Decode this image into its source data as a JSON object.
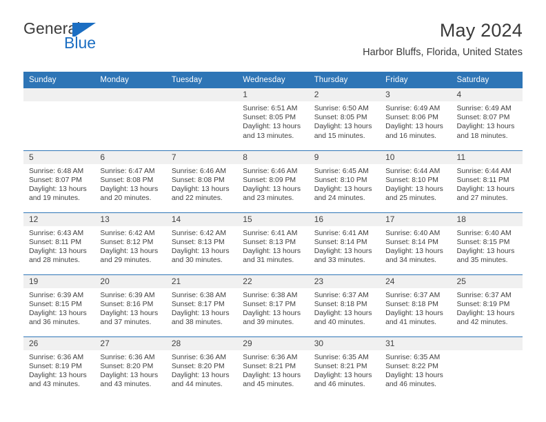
{
  "logo": {
    "word_general": "General",
    "word_blue": "Blue",
    "flag_color": "#1b6ec2"
  },
  "header": {
    "title": "May 2024",
    "subtitle": "Harbor Bluffs, Florida, United States",
    "accent_color": "#2e75b6",
    "daynum_band_color": "#f0f0f0"
  },
  "weekdays": [
    "Sunday",
    "Monday",
    "Tuesday",
    "Wednesday",
    "Thursday",
    "Friday",
    "Saturday"
  ],
  "labels": {
    "sunrise": "Sunrise:",
    "sunset": "Sunset:",
    "daylight": "Daylight:"
  },
  "weeks": [
    [
      {
        "day": "",
        "blank": true
      },
      {
        "day": "",
        "blank": true
      },
      {
        "day": "",
        "blank": true
      },
      {
        "day": "1",
        "sunrise": "Sunrise: 6:51 AM",
        "sunset": "Sunset: 8:05 PM",
        "daylight": "Daylight: 13 hours and 13 minutes."
      },
      {
        "day": "2",
        "sunrise": "Sunrise: 6:50 AM",
        "sunset": "Sunset: 8:05 PM",
        "daylight": "Daylight: 13 hours and 15 minutes."
      },
      {
        "day": "3",
        "sunrise": "Sunrise: 6:49 AM",
        "sunset": "Sunset: 8:06 PM",
        "daylight": "Daylight: 13 hours and 16 minutes."
      },
      {
        "day": "4",
        "sunrise": "Sunrise: 6:49 AM",
        "sunset": "Sunset: 8:07 PM",
        "daylight": "Daylight: 13 hours and 18 minutes."
      }
    ],
    [
      {
        "day": "5",
        "sunrise": "Sunrise: 6:48 AM",
        "sunset": "Sunset: 8:07 PM",
        "daylight": "Daylight: 13 hours and 19 minutes."
      },
      {
        "day": "6",
        "sunrise": "Sunrise: 6:47 AM",
        "sunset": "Sunset: 8:08 PM",
        "daylight": "Daylight: 13 hours and 20 minutes."
      },
      {
        "day": "7",
        "sunrise": "Sunrise: 6:46 AM",
        "sunset": "Sunset: 8:08 PM",
        "daylight": "Daylight: 13 hours and 22 minutes."
      },
      {
        "day": "8",
        "sunrise": "Sunrise: 6:46 AM",
        "sunset": "Sunset: 8:09 PM",
        "daylight": "Daylight: 13 hours and 23 minutes."
      },
      {
        "day": "9",
        "sunrise": "Sunrise: 6:45 AM",
        "sunset": "Sunset: 8:10 PM",
        "daylight": "Daylight: 13 hours and 24 minutes."
      },
      {
        "day": "10",
        "sunrise": "Sunrise: 6:44 AM",
        "sunset": "Sunset: 8:10 PM",
        "daylight": "Daylight: 13 hours and 25 minutes."
      },
      {
        "day": "11",
        "sunrise": "Sunrise: 6:44 AM",
        "sunset": "Sunset: 8:11 PM",
        "daylight": "Daylight: 13 hours and 27 minutes."
      }
    ],
    [
      {
        "day": "12",
        "sunrise": "Sunrise: 6:43 AM",
        "sunset": "Sunset: 8:11 PM",
        "daylight": "Daylight: 13 hours and 28 minutes."
      },
      {
        "day": "13",
        "sunrise": "Sunrise: 6:42 AM",
        "sunset": "Sunset: 8:12 PM",
        "daylight": "Daylight: 13 hours and 29 minutes."
      },
      {
        "day": "14",
        "sunrise": "Sunrise: 6:42 AM",
        "sunset": "Sunset: 8:13 PM",
        "daylight": "Daylight: 13 hours and 30 minutes."
      },
      {
        "day": "15",
        "sunrise": "Sunrise: 6:41 AM",
        "sunset": "Sunset: 8:13 PM",
        "daylight": "Daylight: 13 hours and 31 minutes."
      },
      {
        "day": "16",
        "sunrise": "Sunrise: 6:41 AM",
        "sunset": "Sunset: 8:14 PM",
        "daylight": "Daylight: 13 hours and 33 minutes."
      },
      {
        "day": "17",
        "sunrise": "Sunrise: 6:40 AM",
        "sunset": "Sunset: 8:14 PM",
        "daylight": "Daylight: 13 hours and 34 minutes."
      },
      {
        "day": "18",
        "sunrise": "Sunrise: 6:40 AM",
        "sunset": "Sunset: 8:15 PM",
        "daylight": "Daylight: 13 hours and 35 minutes."
      }
    ],
    [
      {
        "day": "19",
        "sunrise": "Sunrise: 6:39 AM",
        "sunset": "Sunset: 8:15 PM",
        "daylight": "Daylight: 13 hours and 36 minutes."
      },
      {
        "day": "20",
        "sunrise": "Sunrise: 6:39 AM",
        "sunset": "Sunset: 8:16 PM",
        "daylight": "Daylight: 13 hours and 37 minutes."
      },
      {
        "day": "21",
        "sunrise": "Sunrise: 6:38 AM",
        "sunset": "Sunset: 8:17 PM",
        "daylight": "Daylight: 13 hours and 38 minutes."
      },
      {
        "day": "22",
        "sunrise": "Sunrise: 6:38 AM",
        "sunset": "Sunset: 8:17 PM",
        "daylight": "Daylight: 13 hours and 39 minutes."
      },
      {
        "day": "23",
        "sunrise": "Sunrise: 6:37 AM",
        "sunset": "Sunset: 8:18 PM",
        "daylight": "Daylight: 13 hours and 40 minutes."
      },
      {
        "day": "24",
        "sunrise": "Sunrise: 6:37 AM",
        "sunset": "Sunset: 8:18 PM",
        "daylight": "Daylight: 13 hours and 41 minutes."
      },
      {
        "day": "25",
        "sunrise": "Sunrise: 6:37 AM",
        "sunset": "Sunset: 8:19 PM",
        "daylight": "Daylight: 13 hours and 42 minutes."
      }
    ],
    [
      {
        "day": "26",
        "sunrise": "Sunrise: 6:36 AM",
        "sunset": "Sunset: 8:19 PM",
        "daylight": "Daylight: 13 hours and 43 minutes."
      },
      {
        "day": "27",
        "sunrise": "Sunrise: 6:36 AM",
        "sunset": "Sunset: 8:20 PM",
        "daylight": "Daylight: 13 hours and 43 minutes."
      },
      {
        "day": "28",
        "sunrise": "Sunrise: 6:36 AM",
        "sunset": "Sunset: 8:20 PM",
        "daylight": "Daylight: 13 hours and 44 minutes."
      },
      {
        "day": "29",
        "sunrise": "Sunrise: 6:36 AM",
        "sunset": "Sunset: 8:21 PM",
        "daylight": "Daylight: 13 hours and 45 minutes."
      },
      {
        "day": "30",
        "sunrise": "Sunrise: 6:35 AM",
        "sunset": "Sunset: 8:21 PM",
        "daylight": "Daylight: 13 hours and 46 minutes."
      },
      {
        "day": "31",
        "sunrise": "Sunrise: 6:35 AM",
        "sunset": "Sunset: 8:22 PM",
        "daylight": "Daylight: 13 hours and 46 minutes."
      },
      {
        "day": "",
        "blank": true
      }
    ]
  ]
}
